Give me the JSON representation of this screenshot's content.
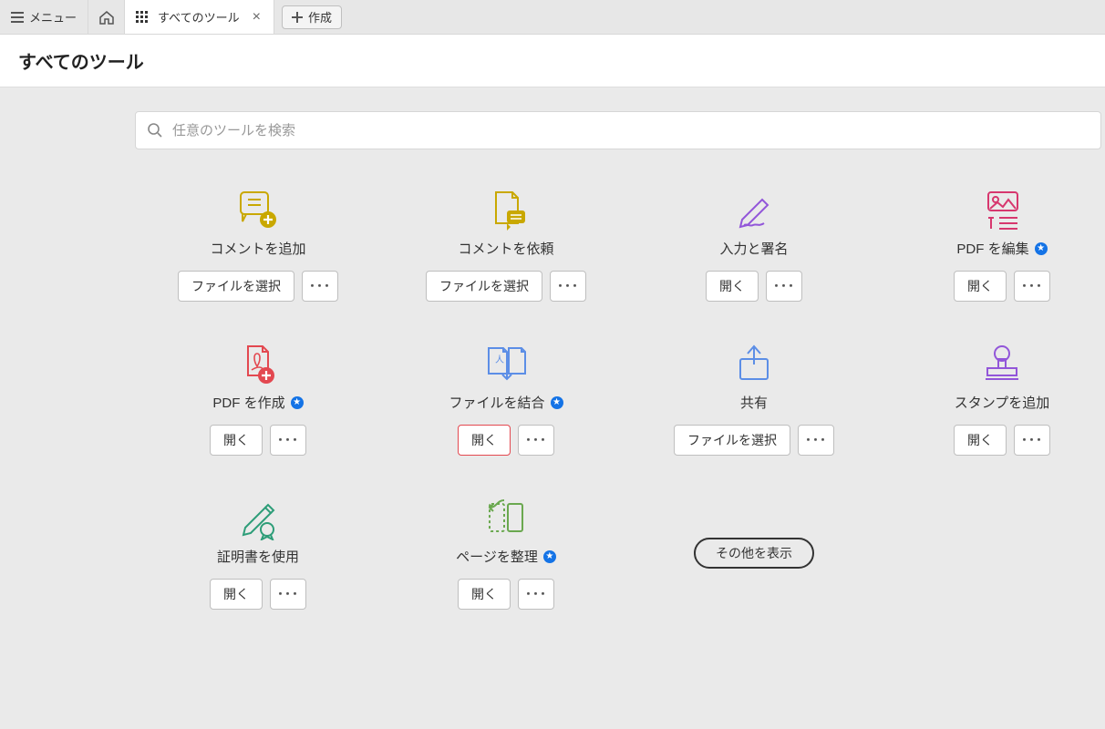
{
  "topbar": {
    "menu_label": "メニュー",
    "tab_label": "すべてのツール",
    "create_label": "作成"
  },
  "page_title": "すべてのツール",
  "search": {
    "placeholder": "任意のツールを検索"
  },
  "buttons": {
    "select_file": "ファイルを選択",
    "open": "開く",
    "more": "･･･",
    "show_more": "その他を表示"
  },
  "tools": [
    {
      "title": "コメントを追加",
      "primary": "select_file",
      "premium": false
    },
    {
      "title": "コメントを依頼",
      "primary": "select_file",
      "premium": false
    },
    {
      "title": "入力と署名",
      "primary": "open",
      "premium": false
    },
    {
      "title": "PDF を編集",
      "primary": "open",
      "premium": true
    },
    {
      "title": "PDF を作成",
      "primary": "open",
      "premium": true
    },
    {
      "title": "ファイルを結合",
      "primary": "open",
      "premium": true,
      "highlight": true
    },
    {
      "title": "共有",
      "primary": "select_file",
      "premium": false
    },
    {
      "title": "スタンプを追加",
      "primary": "open",
      "premium": false
    },
    {
      "title": "証明書を使用",
      "primary": "open",
      "premium": false
    },
    {
      "title": "ページを整理",
      "primary": "open",
      "premium": true
    }
  ]
}
